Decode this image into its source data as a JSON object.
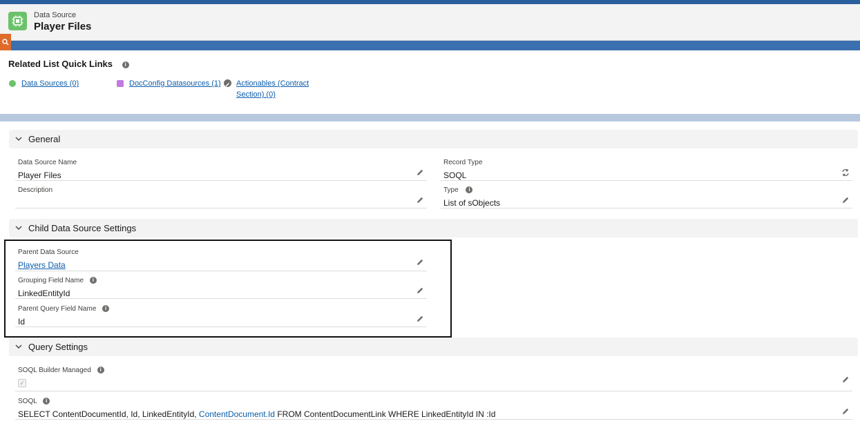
{
  "header": {
    "object_label": "Data Source",
    "record_title": "Player Files",
    "icon": "datasource-chip-icon"
  },
  "quick_links": {
    "title": "Related List Quick Links",
    "items": [
      {
        "label": "Data Sources (0)",
        "icon_color": "#6cc26a"
      },
      {
        "label": "DocConfig Datasources (1)",
        "icon_color": "#c279e0"
      },
      {
        "label_line1": "Actionables (Contract",
        "label_line2": "Section) (0)",
        "icon": "wrench-icon"
      }
    ]
  },
  "sections": {
    "general": {
      "title": "General",
      "fields": {
        "data_source_name": {
          "label": "Data Source Name",
          "value": "Player Files"
        },
        "description": {
          "label": "Description",
          "value": ""
        },
        "record_type": {
          "label": "Record Type",
          "value": "SOQL"
        },
        "type": {
          "label": "Type",
          "value": "List of sObjects"
        }
      }
    },
    "child": {
      "title": "Child Data Source Settings",
      "fields": {
        "parent_data_source": {
          "label": "Parent Data Source",
          "value": "Players Data"
        },
        "grouping_field_name": {
          "label": "Grouping Field Name",
          "value": "LinkedEntityId"
        },
        "parent_query_field_name": {
          "label": "Parent Query Field Name",
          "value": "Id"
        }
      }
    },
    "query": {
      "title": "Query Settings",
      "fields": {
        "soql_builder_managed": {
          "label": "SOQL Builder Managed",
          "checked": true
        },
        "soql": {
          "label": "SOQL",
          "value_part1": "SELECT ContentDocumentId, Id, LinkedEntityId, ",
          "value_link": "ContentDocument.Id",
          "value_part2": " FROM ContentDocumentLink WHERE LinkedEntityId IN :Id"
        }
      }
    }
  },
  "colors": {
    "brand_blue": "#2a5f9e",
    "link": "#0b5cab",
    "icon_green": "#6cc26a"
  }
}
